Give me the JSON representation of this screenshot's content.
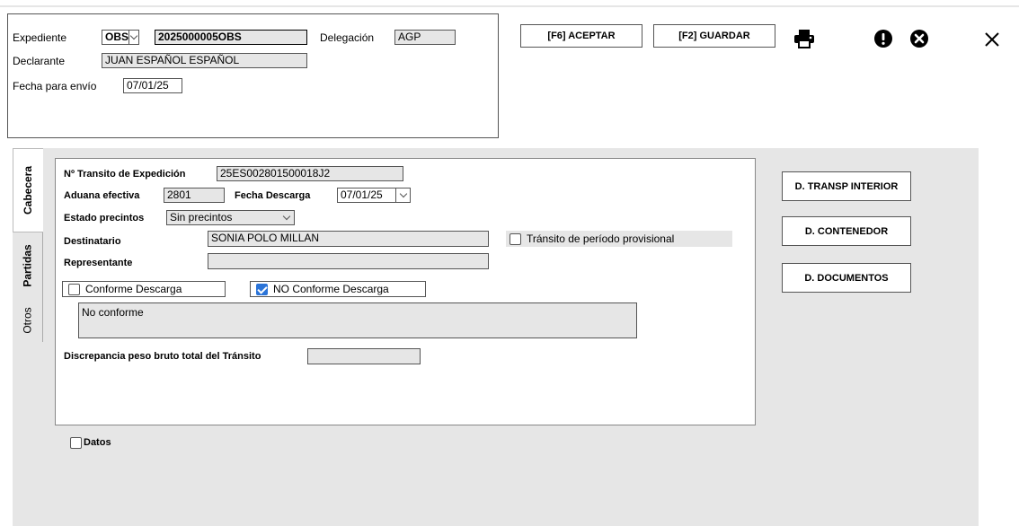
{
  "header": {
    "expediente_label": "Expediente",
    "expediente_prefix": "OBS",
    "expediente_number": "2025000005OBS",
    "delegacion_label": "Delegación",
    "delegacion_value": "AGP",
    "declarante_label": "Declarante",
    "declarante_value": "JUAN ESPAÑOL ESPAÑOL",
    "fecha_envio_label": "Fecha para envío",
    "fecha_envio_value": "07/01/25"
  },
  "toolbar": {
    "aceptar_label": "[F6] ACEPTAR",
    "guardar_label": "[F2] GUARDAR",
    "print_icon": "printer-icon",
    "warning_icon": "exclamation-circle-icon",
    "cancel_icon": "x-circle-icon",
    "close_icon": "close-icon"
  },
  "tabs": [
    {
      "label": "Cabecera",
      "active": true
    },
    {
      "label": "Partidas",
      "active": false
    },
    {
      "label": "Otros",
      "active": false
    }
  ],
  "form": {
    "transito_label": "Nº Transito de Expedición",
    "transito_value": "25ES002801500018J2",
    "aduana_label": "Aduana efectiva",
    "aduana_value": "2801",
    "fecha_descarga_label": "Fecha Descarga",
    "fecha_descarga_value": "07/01/25",
    "estado_label": "Estado precintos",
    "estado_value": "Sin precintos",
    "destinatario_label": "Destinatario",
    "destinatario_value": "SONIA POLO MILLAN",
    "transito_provisional_label": "Tránsito de período provisional",
    "transito_provisional_checked": false,
    "representante_label": "Representante",
    "representante_value": "",
    "conforme_label": "Conforme Descarga",
    "conforme_checked": false,
    "no_conforme_label": "NO Conforme Descarga",
    "no_conforme_checked": true,
    "observaciones_value": "No conforme",
    "discrepancia_label": "Discrepancia peso bruto total del Tránsito",
    "discrepancia_value": ""
  },
  "side_buttons": {
    "transp_interior": "D. TRANSP INTERIOR",
    "contenedor": "D. CONTENEDOR",
    "documentos": "D. DOCUMENTOS"
  },
  "datos": {
    "label": "Datos",
    "checked": false
  },
  "colors": {
    "panel_bg": "#e6e6e6",
    "field_bg": "#e6e6e6",
    "checkbox_on": "#2b74d8"
  }
}
